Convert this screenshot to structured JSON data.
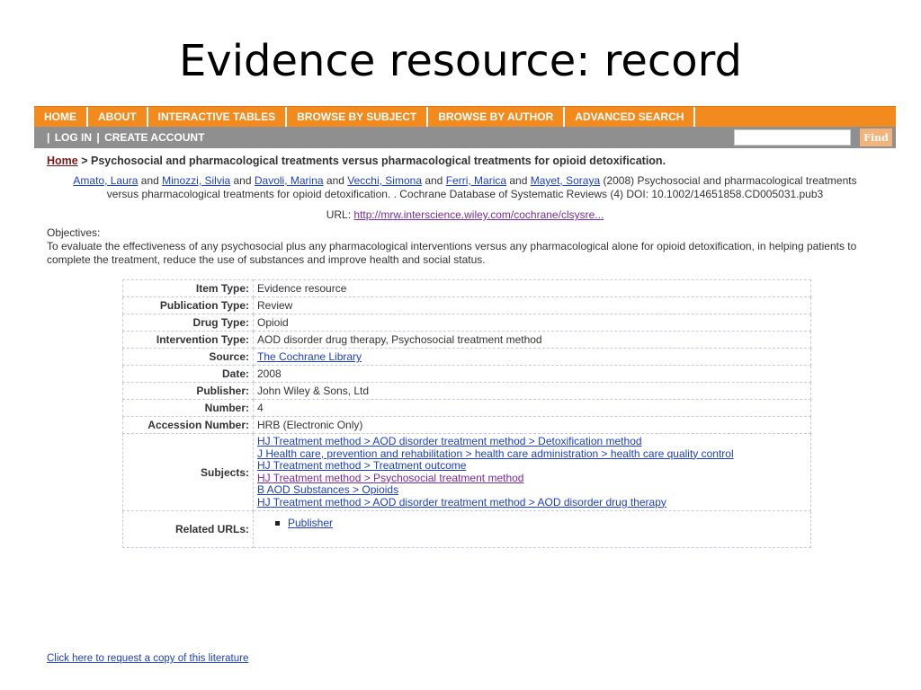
{
  "slide": {
    "title": "Evidence resource: record"
  },
  "nav": {
    "items": [
      "HOME",
      "ABOUT",
      "INTERACTIVE TABLES",
      "BROWSE BY SUBJECT",
      "BROWSE BY AUTHOR",
      "ADVANCED SEARCH"
    ]
  },
  "subnav": {
    "leading_sep": "|",
    "login": "LOG IN",
    "sep": "|",
    "create": "CREATE ACCOUNT",
    "search_value": "",
    "find": "Find"
  },
  "breadcrumb": {
    "home": "Home",
    "rest": " > Psychosocial and pharmacological treatments versus pharmacological treatments for opioid detoxification."
  },
  "citation": {
    "authors": [
      "Amato, Laura",
      "Minozzi, Silvia",
      "Davoli, Marina",
      "Vecchi, Simona",
      "Ferri, Marica",
      "Mayet, Soraya"
    ],
    "and": " and ",
    "text": " (2008) Psychosocial and pharmacological treatments versus pharmacological treatments for opioid detoxification. . Cochrane Database of Systematic Reviews (4) DOI: 10.1002/14651858.CD005031.pub3"
  },
  "url": {
    "label": "URL: ",
    "link": "http://mrw.interscience.wiley.com/cochrane/clsysre..."
  },
  "objectives": {
    "label": "Objectives:",
    "text": "To evaluate the effectiveness of any psychosocial plus any pharmacological interventions versus any pharmacological alone for opioid detoxification, in helping patients to complete the treatment, reduce the use of substances and improve health and social status."
  },
  "details": {
    "item_type": {
      "label": "Item Type:",
      "value": "Evidence resource"
    },
    "publication_type": {
      "label": "Publication Type:",
      "value": "Review"
    },
    "drug_type": {
      "label": "Drug Type:",
      "value": "Opioid"
    },
    "intervention_type": {
      "label": "Intervention Type:",
      "value": "AOD disorder drug therapy, Psychosocial treatment method"
    },
    "source": {
      "label": "Source:",
      "value": "The Cochrane Library"
    },
    "date": {
      "label": "Date:",
      "value": "2008"
    },
    "publisher": {
      "label": "Publisher:",
      "value": "John Wiley & Sons, Ltd"
    },
    "number": {
      "label": "Number:",
      "value": "4"
    },
    "accession": {
      "label": "Accession Number:",
      "value": "HRB (Electronic Only)"
    },
    "subjects": {
      "label": "Subjects:",
      "items": [
        "HJ Treatment method > AOD disorder treatment method > Detoxification method",
        "J Health care, prevention and rehabilitation > health care administration > health care quality control",
        "HJ Treatment method > Treatment outcome",
        "HJ Treatment method > Psychosocial treatment method",
        "B AOD Substances > Opioids",
        "HJ Treatment method > AOD disorder treatment method > AOD disorder drug therapy"
      ]
    },
    "related": {
      "label": "Related URLs:",
      "items": [
        "Publisher"
      ]
    }
  },
  "request": {
    "link": "Click here to request a copy of this literature"
  },
  "colors": {
    "nav": "#f28a1e",
    "subnav": "#8f8f8f",
    "link": "#1b3fc4",
    "visited": "#7a2a9e"
  }
}
